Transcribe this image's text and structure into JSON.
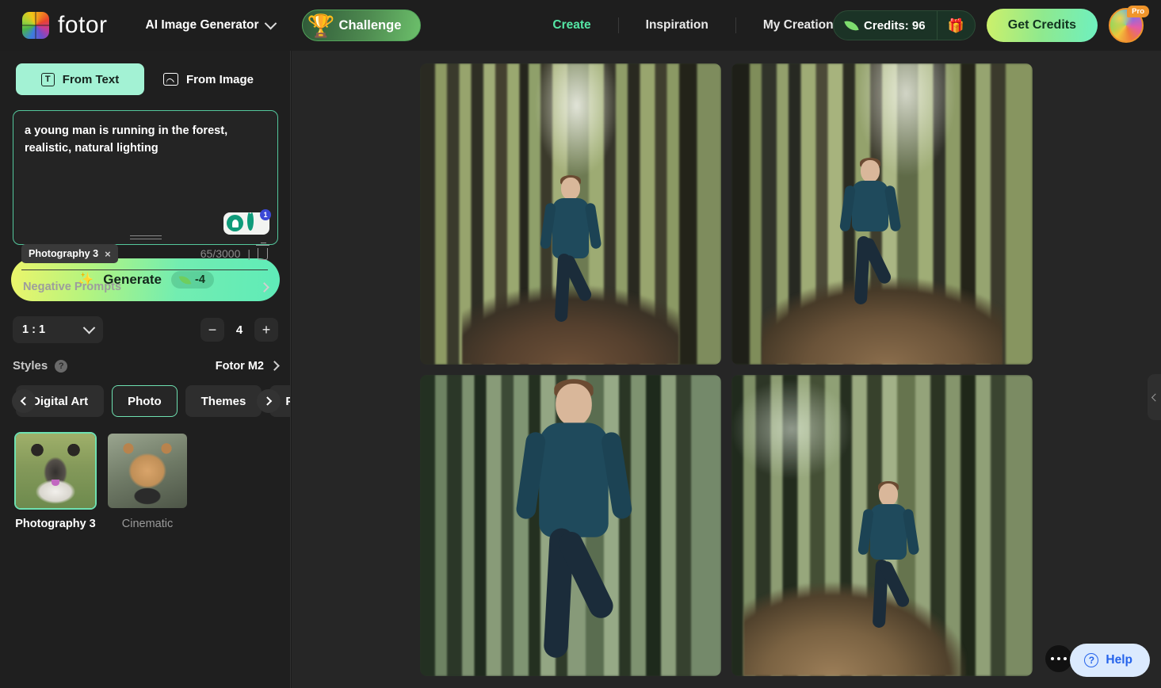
{
  "header": {
    "brand": "fotor",
    "app_selector": "AI Image Generator",
    "challenge_label": "Challenge",
    "nav": [
      {
        "label": "Create",
        "active": true
      },
      {
        "label": "Inspiration",
        "active": false
      },
      {
        "label": "My Creation",
        "active": false
      }
    ],
    "credits_label": "Credits: 96",
    "gift_icon": "gift-icon",
    "get_credits_label": "Get Credits",
    "pro_badge": "Pro",
    "accent_green": "#55e6a5",
    "accent_mint": "#a3f2d4"
  },
  "sidebar": {
    "tabs": [
      {
        "label": "From Text",
        "icon": "text-icon",
        "active": true
      },
      {
        "label": "From Image",
        "icon": "image-icon",
        "active": false
      }
    ],
    "prompt": {
      "value": "a young man is running in the forest, realistic, natural lighting",
      "counter": "65/3000",
      "inspire_icon": "lightbulb-icon",
      "rewrite_icon": "rewrite-icon",
      "rewrite_badge": "1",
      "clear_icon": "trash-icon",
      "style_tag": "Photography 3",
      "tag_close": "×",
      "negative_prompts_label": "Negative Prompts"
    },
    "generate": {
      "label": "Generate",
      "cost": "-4",
      "magic_icon": "magic-wand-icon"
    },
    "ratio": {
      "value": "1 : 1",
      "count": "4",
      "minus": "−",
      "plus": "+"
    },
    "styles": {
      "title": "Styles",
      "help_icon": "question-icon",
      "model": "Fotor M2",
      "categories": [
        {
          "label": "Digital Art",
          "active": false
        },
        {
          "label": "Photo",
          "active": true
        },
        {
          "label": "Themes",
          "active": false
        },
        {
          "label": "Paint",
          "active": false
        }
      ],
      "cards": [
        {
          "label": "Photography 3",
          "selected": true
        },
        {
          "label": "Cinematic",
          "selected": false
        }
      ]
    }
  },
  "canvas": {
    "results": [
      {
        "alt": "man running on forest trail, long sleeve teal top"
      },
      {
        "alt": "man running in sunlit pine forest, teal t-shirt"
      },
      {
        "alt": "close up man running through green forest, teal t-shirt"
      },
      {
        "alt": "man running on sunny forest path, teal jacket"
      }
    ],
    "more_icon": "more-options-icon",
    "help_label": "Help",
    "collapse_icon": "chevron-left-icon"
  }
}
